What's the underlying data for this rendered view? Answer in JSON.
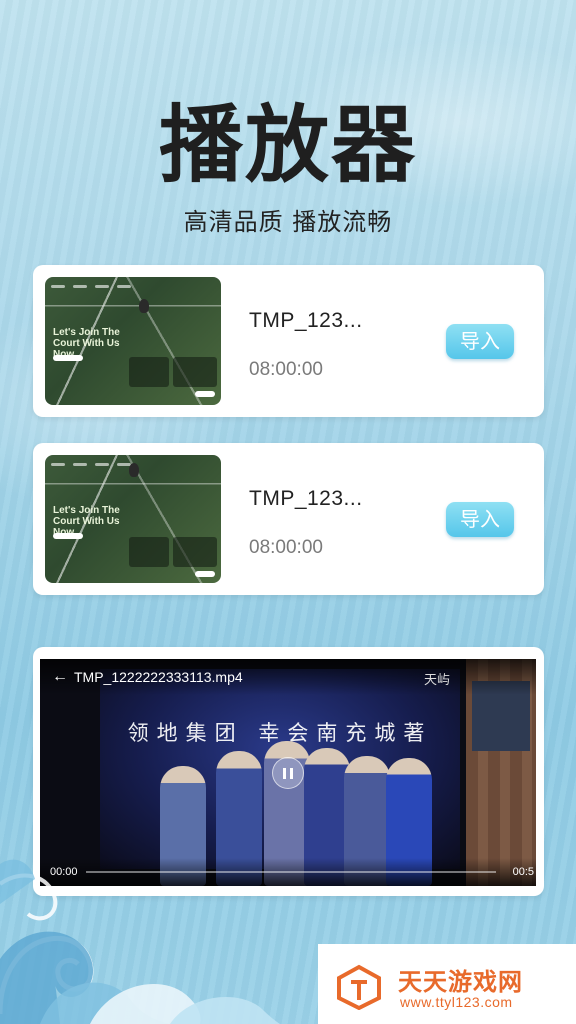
{
  "header": {
    "title": "播放器",
    "subtitle": "高清品质 播放流畅"
  },
  "files": [
    {
      "name": "TMP_123...",
      "duration": "08:00:00",
      "import_label": "导入",
      "thumbnail_headline": "Let's Join The\nCourt With Us\nNow"
    },
    {
      "name": "TMP_123...",
      "duration": "08:00:00",
      "import_label": "导入",
      "thumbnail_headline": "Let's Join The\nCourt With Us\nNow"
    }
  ],
  "player": {
    "file_title": "TMP_1222222333113.mp4",
    "brand": "天屿",
    "banner_text": "领地集团 幸会南充城著",
    "current_time": "00:00",
    "end_time": "00:5",
    "progress": 0.0,
    "icons": [
      "back-arrow-icon",
      "pause-icon"
    ]
  },
  "watermark": {
    "name": "天天游戏网",
    "url": "www.ttyl123.com"
  },
  "colors": {
    "background": "#a9d7ea",
    "import_button": "#55c6ea",
    "watermark": "#e86a2b",
    "title": "#1f1f1f"
  }
}
